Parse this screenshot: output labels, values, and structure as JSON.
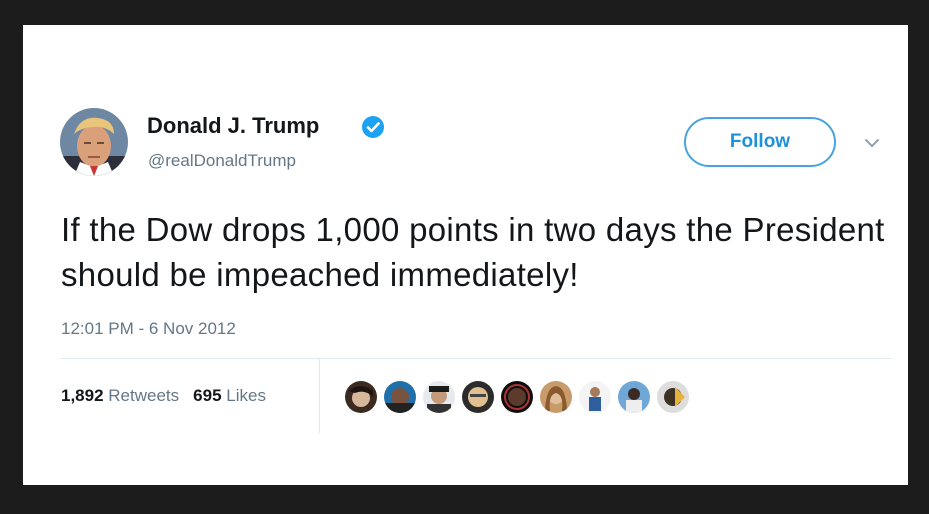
{
  "tweet": {
    "display_name": "Donald J. Trump",
    "handle": "@realDonaldTrump",
    "verified": true,
    "follow_label": "Follow",
    "text": "If the Dow drops 1,000 points in two days the President should be impeached immediately!",
    "timestamp": "12:01 PM - 6 Nov 2012",
    "retweets_count": "1,892",
    "retweets_label": "Retweets",
    "likes_count": "695",
    "likes_label": "Likes"
  },
  "icons": {
    "verified": "verified-badge-icon",
    "caret": "chevron-down-icon"
  },
  "colors": {
    "accent": "#1da1f2",
    "text": "#14171a",
    "muted": "#657786",
    "border": "#e1e8ed",
    "frame": "#1c1c1c"
  },
  "likers_count_visible": 9
}
